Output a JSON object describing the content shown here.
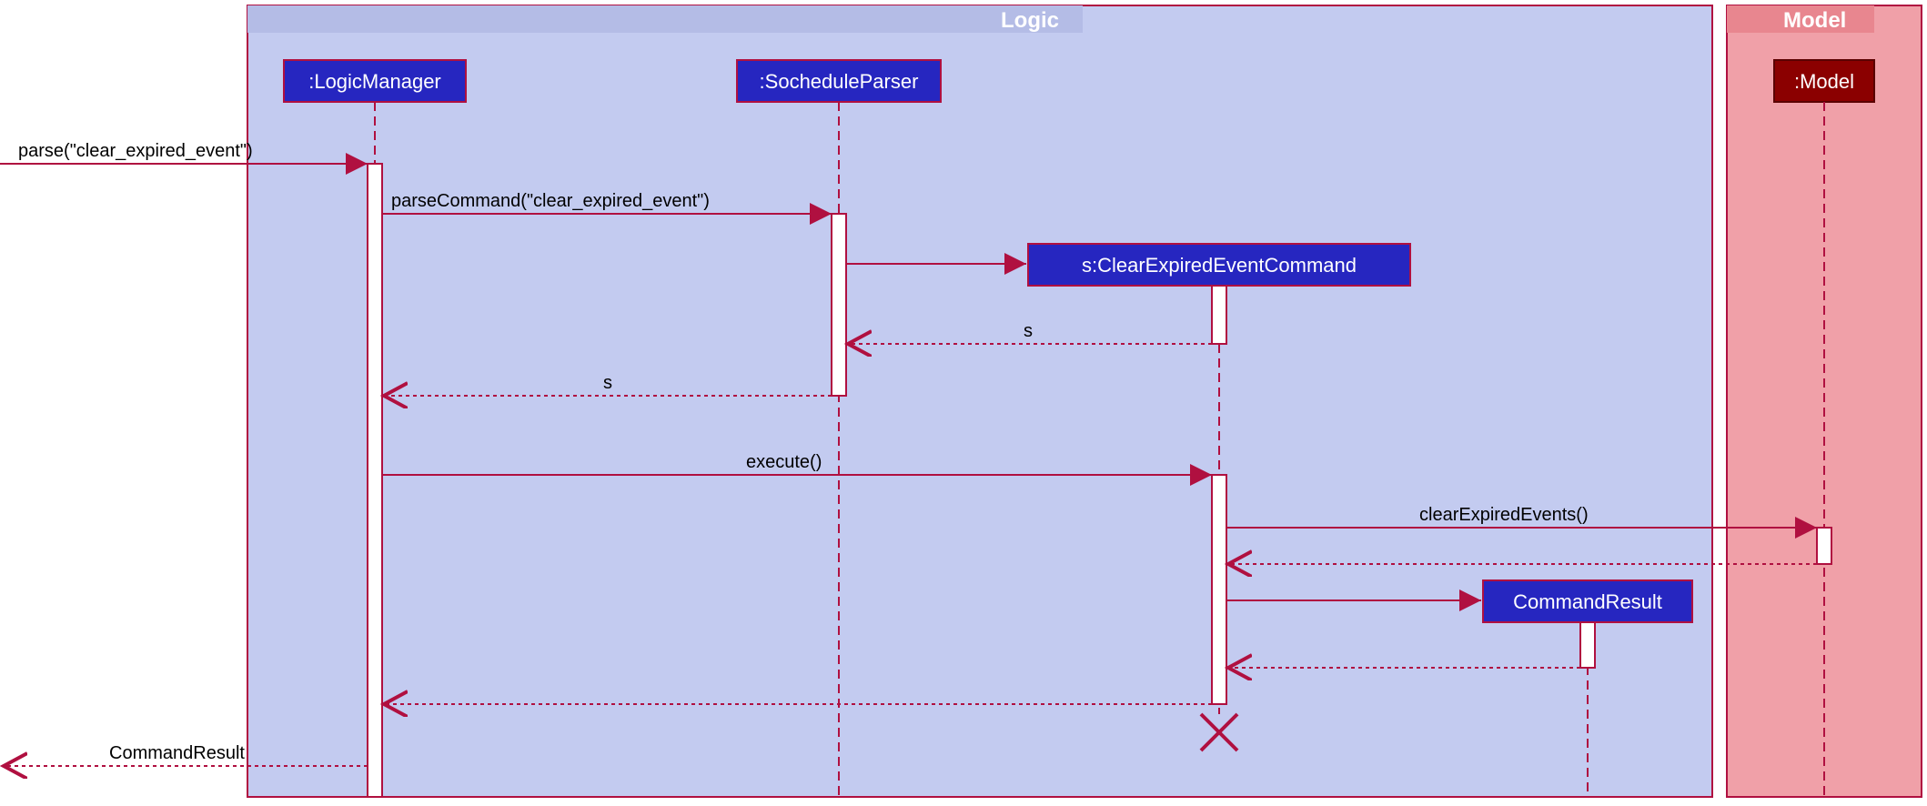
{
  "frames": {
    "logic_label": "Logic",
    "model_label": "Model"
  },
  "participants": {
    "logic_manager": ":LogicManager",
    "sochedule_parser": ":SocheduleParser",
    "clear_cmd": "s:ClearExpiredEventCommand",
    "command_result": "CommandResult",
    "model": ":Model"
  },
  "messages": {
    "parse_in": "parse(\"clear_expired_event\")",
    "parse_command": "parseCommand(\"clear_expired_event\")",
    "return_s1": "s",
    "return_s2": "s",
    "execute": "execute()",
    "clear_expired": "clearExpiredEvents()",
    "command_result_out": "CommandResult"
  },
  "chart_data": {
    "type": "sequence_diagram",
    "frames": [
      {
        "name": "Logic",
        "participants": [
          "LogicManager",
          "SocheduleParser",
          "ClearExpiredEventCommand",
          "CommandResult"
        ]
      },
      {
        "name": "Model",
        "participants": [
          "Model"
        ]
      }
    ],
    "participants": [
      {
        "id": "LogicManager",
        "label": ":LogicManager"
      },
      {
        "id": "SocheduleParser",
        "label": ":SocheduleParser"
      },
      {
        "id": "ClearExpiredEventCommand",
        "label": "s:ClearExpiredEventCommand",
        "created": true,
        "destroyed": true
      },
      {
        "id": "CommandResult",
        "label": "CommandResult",
        "created": true
      },
      {
        "id": "Model",
        "label": ":Model"
      }
    ],
    "messages": [
      {
        "from": "external",
        "to": "LogicManager",
        "label": "parse(\"clear_expired_event\")",
        "type": "sync"
      },
      {
        "from": "LogicManager",
        "to": "SocheduleParser",
        "label": "parseCommand(\"clear_expired_event\")",
        "type": "sync"
      },
      {
        "from": "SocheduleParser",
        "to": "ClearExpiredEventCommand",
        "label": "",
        "type": "create"
      },
      {
        "from": "ClearExpiredEventCommand",
        "to": "SocheduleParser",
        "label": "s",
        "type": "return"
      },
      {
        "from": "SocheduleParser",
        "to": "LogicManager",
        "label": "s",
        "type": "return"
      },
      {
        "from": "LogicManager",
        "to": "ClearExpiredEventCommand",
        "label": "execute()",
        "type": "sync"
      },
      {
        "from": "ClearExpiredEventCommand",
        "to": "Model",
        "label": "clearExpiredEvents()",
        "type": "sync"
      },
      {
        "from": "Model",
        "to": "ClearExpiredEventCommand",
        "label": "",
        "type": "return"
      },
      {
        "from": "ClearExpiredEventCommand",
        "to": "CommandResult",
        "label": "",
        "type": "create"
      },
      {
        "from": "CommandResult",
        "to": "ClearExpiredEventCommand",
        "label": "",
        "type": "return"
      },
      {
        "from": "ClearExpiredEventCommand",
        "to": "LogicManager",
        "label": "",
        "type": "return"
      },
      {
        "from": "ClearExpiredEventCommand",
        "action": "destroy"
      },
      {
        "from": "LogicManager",
        "to": "external",
        "label": "CommandResult",
        "type": "return"
      }
    ]
  }
}
